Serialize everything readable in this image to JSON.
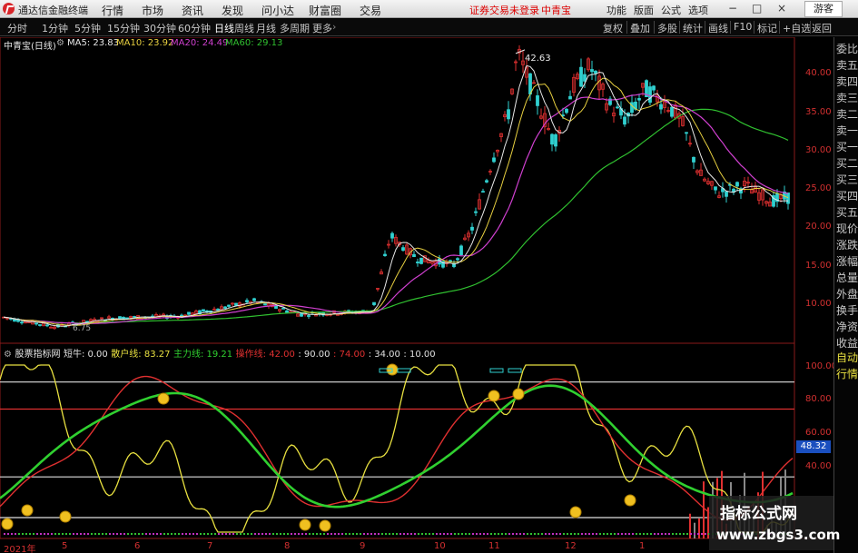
{
  "menubar": {
    "app_title": "通达信金融终端",
    "items": [
      "行情",
      "市场",
      "资讯",
      "发现",
      "问小达",
      "财富圈",
      "交易"
    ],
    "notice": "证券交易未登录",
    "stock_name": "中青宝",
    "right_items": [
      "功能",
      "版面",
      "公式",
      "选项"
    ],
    "guest": "游客",
    "win_controls": [
      "−",
      "□",
      "×"
    ]
  },
  "toolbar": {
    "periods": [
      "分时",
      "1分钟",
      "5分钟",
      "15分钟",
      "30分钟",
      "60分钟",
      "日线",
      "周线",
      "月线",
      "多周期",
      "更多"
    ],
    "active": "日线",
    "right_items": [
      "复权",
      "叠加",
      "多股",
      "统计",
      "画线",
      "F10",
      "标记",
      "+自选",
      "返回"
    ]
  },
  "main_chart": {
    "title": "中青宝(日线)",
    "ma": [
      {
        "label": "MA5: 23.83",
        "color": "#e8e8e8"
      },
      {
        "label": "MA10: 23.92",
        "color": "#e8d040"
      },
      {
        "label": "MA20: 24.49",
        "color": "#d040d0"
      },
      {
        "label": "MA60: 29.13",
        "color": "#30c030"
      }
    ],
    "high_label": "42.63",
    "low_label": "6.75",
    "y_ticks": [
      "40.00",
      "35.00",
      "30.00",
      "25.00",
      "20.00",
      "15.00",
      "10.00"
    ],
    "y_values": [
      40,
      35,
      30,
      25,
      20,
      15,
      10
    ]
  },
  "indicator": {
    "name": "股票指标网",
    "params": [
      {
        "text": "短牛: 0.00",
        "color": "#e0e0e0"
      },
      {
        "text": "散户线: 83.27",
        "color": "#e8e040"
      },
      {
        "text": "主力线: 19.21",
        "color": "#30d030"
      },
      {
        "text": "操作线: 42.00",
        "color": "#e03030"
      },
      {
        "text": ": 90.00",
        "color": "#e0e0e0"
      },
      {
        "text": ": 74.00",
        "color": "#e03030"
      },
      {
        "text": ": 34.00",
        "color": "#e0e0e0"
      },
      {
        "text": ": 10.00",
        "color": "#e0e0e0"
      }
    ],
    "y_ticks": [
      "100.00",
      "80.00",
      "60.00",
      "40.00"
    ],
    "y_values": [
      100,
      80,
      60,
      40
    ],
    "current_badge": "48.32"
  },
  "x_axis": {
    "labels": [
      "2021年",
      "5",
      "6",
      "7",
      "8",
      "9",
      "10",
      "11",
      "12",
      "1"
    ]
  },
  "sidebar": {
    "items": [
      "委比",
      "卖五",
      "卖四",
      "卖三",
      "卖二",
      "卖一",
      "买一",
      "买二",
      "买三",
      "买四",
      "买五",
      "现价",
      "涨跌",
      "涨幅",
      "总量",
      "外盘",
      "换手",
      "净资",
      "收益",
      "自动",
      "行情"
    ]
  },
  "watermark": {
    "line1": "指标公式网",
    "line2": "www.zbgs3.com"
  },
  "colors": {
    "up": "#e03030",
    "down": "#30d0d0",
    "ma5": "#e8e8e8",
    "ma10": "#e8d040",
    "ma20": "#d040d0",
    "ma60": "#30c030",
    "retail": "#e8e040",
    "main": "#30d030",
    "op": "#e03030"
  }
}
